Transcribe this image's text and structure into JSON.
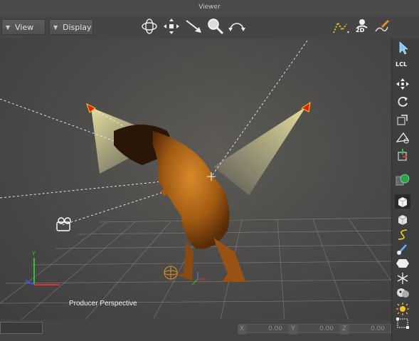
{
  "window": {
    "title": "Viewer"
  },
  "toolbar": {
    "view_label": "View",
    "display_label": "Display",
    "label_2d": "2D"
  },
  "right_toolbar": {
    "local_label": "LCL"
  },
  "viewport": {
    "camera_label": "Producer Perspective"
  },
  "status": {
    "x_label": "X",
    "x_value": "0.00",
    "y_label": "Y",
    "y_value": "0.00",
    "z_label": "Z",
    "z_value": "0.00"
  },
  "colors": {
    "spot_light": "#e02010",
    "beam": "#fff4a0",
    "dino": "#b06010",
    "selected_bg": "#2a2a2a"
  }
}
